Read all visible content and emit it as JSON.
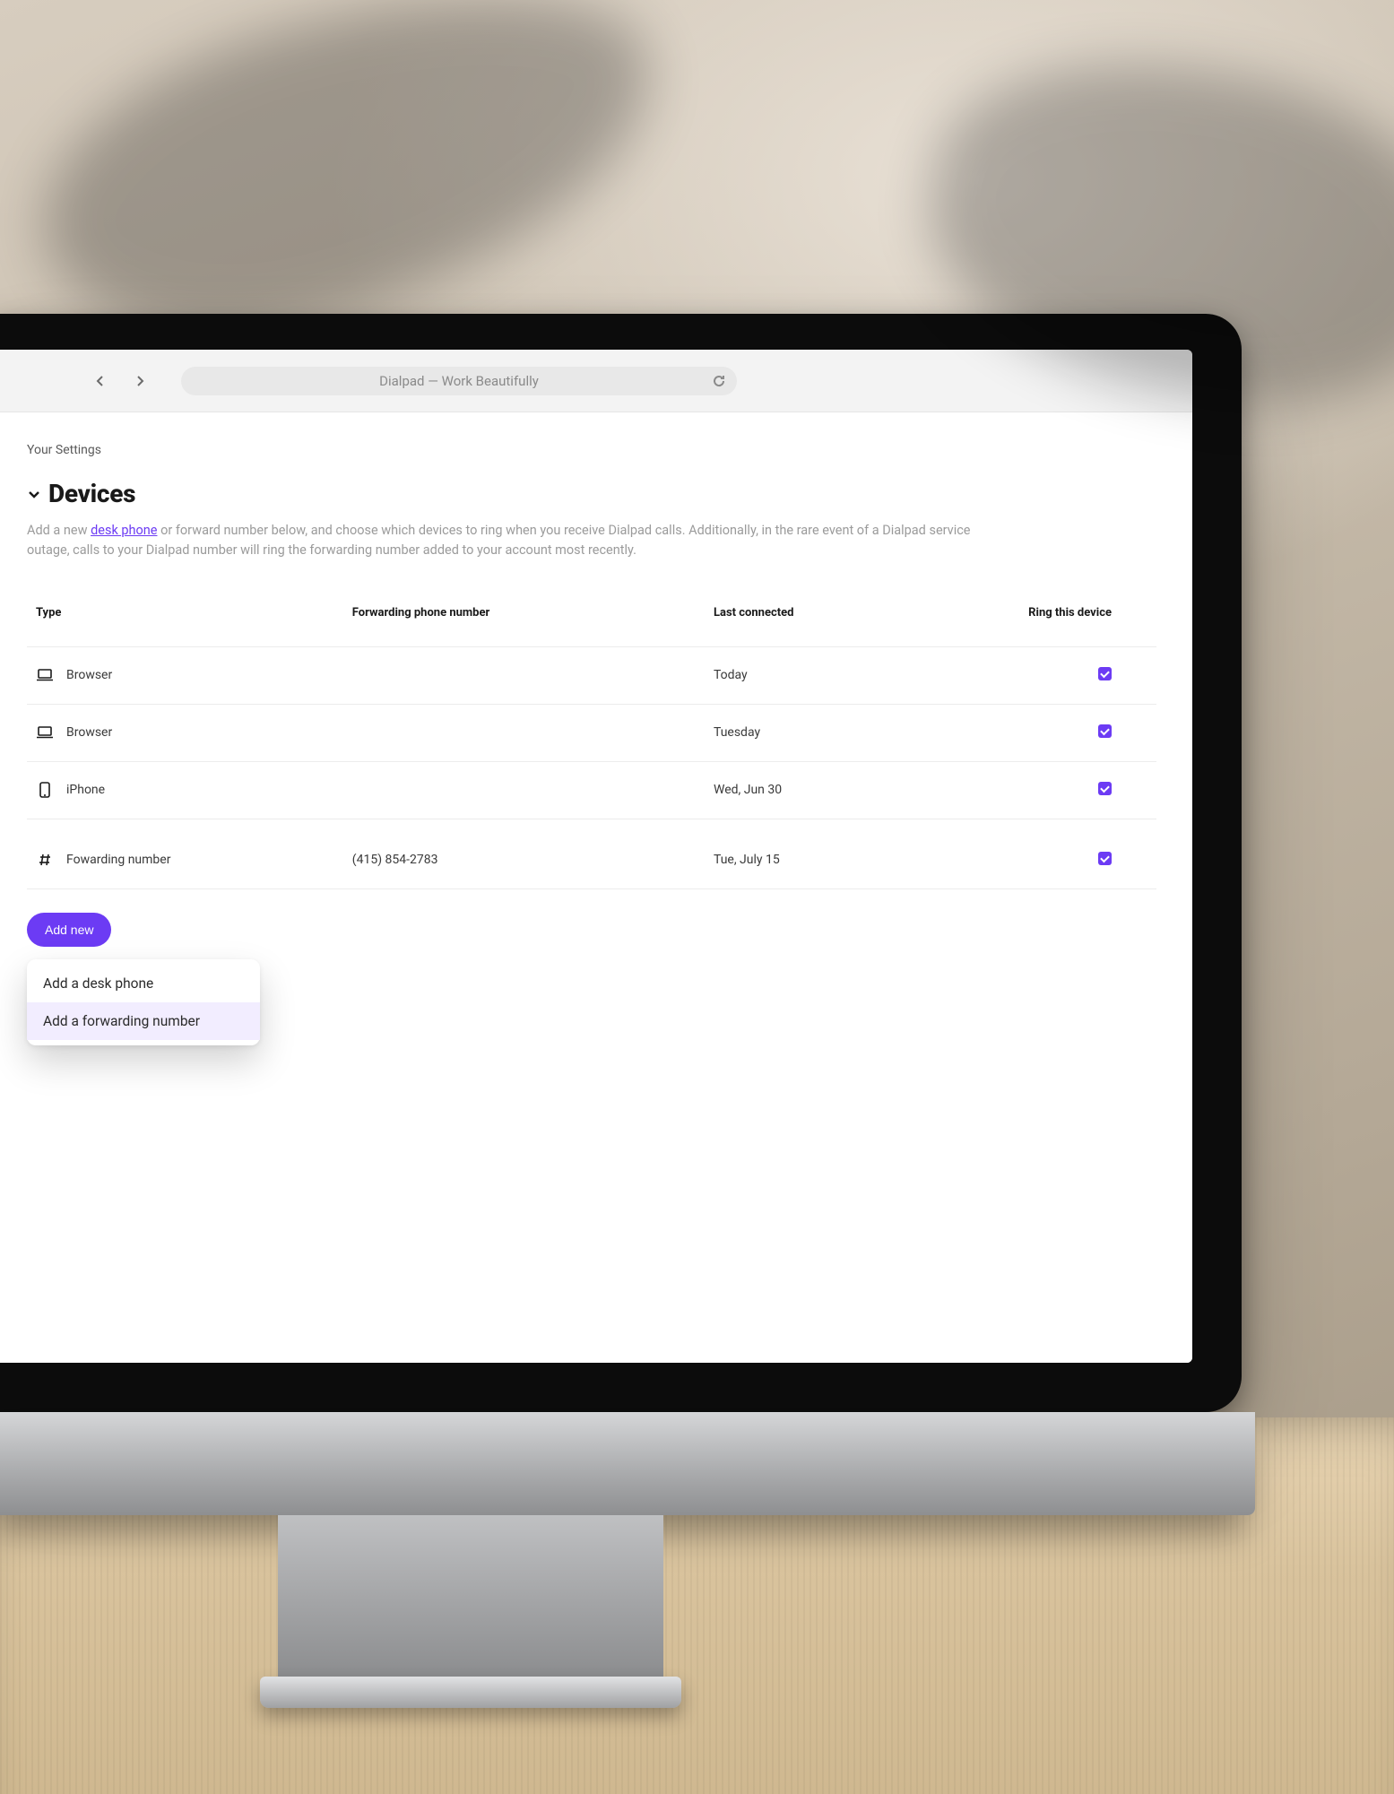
{
  "chrome": {
    "title": "Dialpad — Work Beautifully"
  },
  "breadcrumb": "Your Settings",
  "section": {
    "title": "Devices",
    "description_pre": "Add a new ",
    "description_link": "desk phone",
    "description_post": " or forward number below, and choose which devices to ring when you receive Dialpad calls. Additionally, in the rare event of a Dialpad service outage, calls to your Dialpad number will ring the forwarding number added to your account most recently."
  },
  "table": {
    "headers": {
      "type": "Type",
      "forwarding": "Forwarding phone number",
      "last": "Last connected",
      "ring": "Ring this device"
    },
    "rows": [
      {
        "icon": "laptop",
        "type": "Browser",
        "forwarding": "",
        "last": "Today",
        "ring": true
      },
      {
        "icon": "laptop",
        "type": "Browser",
        "forwarding": "",
        "last": "Tuesday",
        "ring": true
      },
      {
        "icon": "phone",
        "type": "iPhone",
        "forwarding": "",
        "last": "Wed, Jun 30",
        "ring": true
      },
      {
        "icon": "hash",
        "type": "Fowarding number",
        "forwarding": "(415) 854-2783",
        "last": "Tue, July 15",
        "ring": true
      }
    ]
  },
  "actions": {
    "add_new": "Add new",
    "menu": [
      "Add a desk phone",
      "Add a forwarding number"
    ]
  }
}
